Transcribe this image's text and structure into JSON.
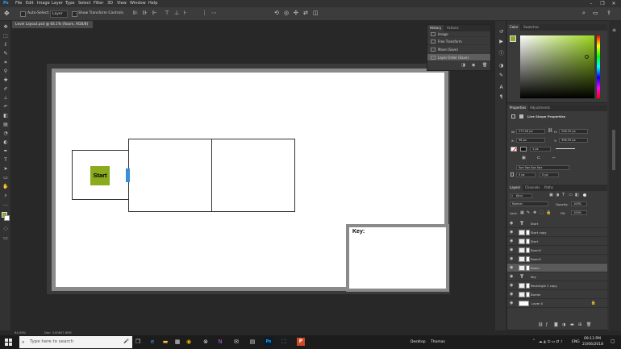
{
  "menubar": {
    "logo": "Ps",
    "items": [
      "File",
      "Edit",
      "Image",
      "Layer",
      "Type",
      "Select",
      "Filter",
      "3D",
      "View",
      "Window",
      "Help"
    ],
    "window_controls": [
      "–",
      "❐",
      "✕"
    ]
  },
  "options": {
    "auto_select_label": "Auto-Select:",
    "auto_select_value": "Layer",
    "show_transform_label": "Show Transform Controls"
  },
  "document": {
    "tab_title": "Level Layout.psd @ 64.1% (Room, RGB/8)",
    "start_label": "Start",
    "key_label": "Key:",
    "zoom": "64.09%",
    "doc_info": "Doc: 3.00M/7.85M"
  },
  "history": {
    "tabs": [
      "History",
      "Actions"
    ],
    "items": [
      {
        "label": "Image",
        "selected": false
      },
      {
        "label": "Free Transform",
        "selected": false
      },
      {
        "label": "Move (Save)",
        "selected": false
      },
      {
        "label": "Layer Order (Save)",
        "selected": true
      }
    ]
  },
  "color": {
    "tabs": [
      "Color",
      "Swatches"
    ],
    "foreground": "#8aab1d",
    "background": "#ffffff"
  },
  "properties": {
    "tabs": [
      "Properties",
      "Adjustments"
    ],
    "title": "Live Shape Properties",
    "w_label": "W:",
    "w_value": "273.26 px",
    "h_label": "H:",
    "h_value": "246.25 px",
    "x_label": "X:",
    "x_value": "98 px",
    "y_label": "Y:",
    "y_value": "396.35 px",
    "stroke_size": "1 px",
    "corner_value": "0px 0px 0px 0px",
    "radius_a": "0 px",
    "radius_b": "0 px"
  },
  "layers": {
    "tabs": [
      "Layers",
      "Channels",
      "Paths"
    ],
    "filter_label": "Kind",
    "blend_mode": "Normal",
    "opacity_label": "Opacity:",
    "opacity_value": "100%",
    "lock_label": "Lock:",
    "fill_label": "Fill:",
    "fill_value": "100%",
    "items": [
      {
        "name": "Start",
        "type": "text",
        "selected": false
      },
      {
        "name": "Start copy",
        "type": "shape",
        "selected": false
      },
      {
        "name": "Start",
        "type": "shape",
        "selected": false
      },
      {
        "name": "Room2",
        "type": "shape",
        "selected": false
      },
      {
        "name": "Room2",
        "type": "shape",
        "selected": false
      },
      {
        "name": "Room",
        "type": "shape",
        "selected": true
      },
      {
        "name": "Key",
        "type": "text",
        "selected": false
      },
      {
        "name": "Rectangle 1 copy",
        "type": "shape",
        "selected": false
      },
      {
        "name": "Border",
        "type": "shape",
        "selected": false
      },
      {
        "name": "Layer 0",
        "type": "background",
        "selected": false
      }
    ]
  },
  "taskbar": {
    "search_placeholder": "Type here to search",
    "desktop_label": "Desktop",
    "user_label": "Thomas",
    "language": "ENG",
    "time": "09:13 PM",
    "date": "23/06/2018"
  }
}
